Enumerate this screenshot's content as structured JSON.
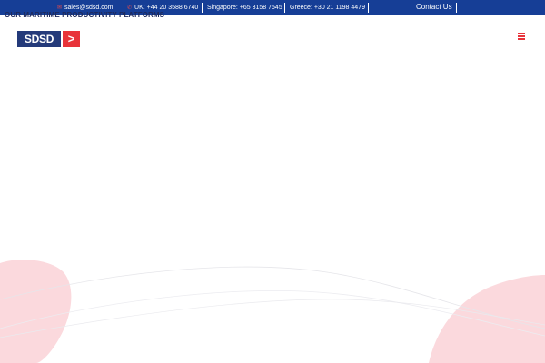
{
  "topbar": {
    "email": "sales@sdsd.com",
    "uk_phone": "UK: +44 20 3588 6740",
    "singapore_phone": "Singapore: +65 3158 7545",
    "greece_phone": "Greece: +30 21 1198 4479",
    "contact_label": "Contact Us",
    "email_icon": "envelope-icon",
    "phone_icon": "phone-icon"
  },
  "header": {
    "overlay_text": "OUR MARITIME PRODUCTIVITY PLATFORMS"
  },
  "logo": {
    "text": "SDSD",
    "arrow": ">"
  },
  "menu": {
    "icon": "hamburger-menu-icon"
  },
  "colors": {
    "topbar_bg": "#163e96",
    "brand_blue": "#243a7a",
    "brand_red": "#e8333a",
    "blob_pink": "#fbd9dd"
  }
}
